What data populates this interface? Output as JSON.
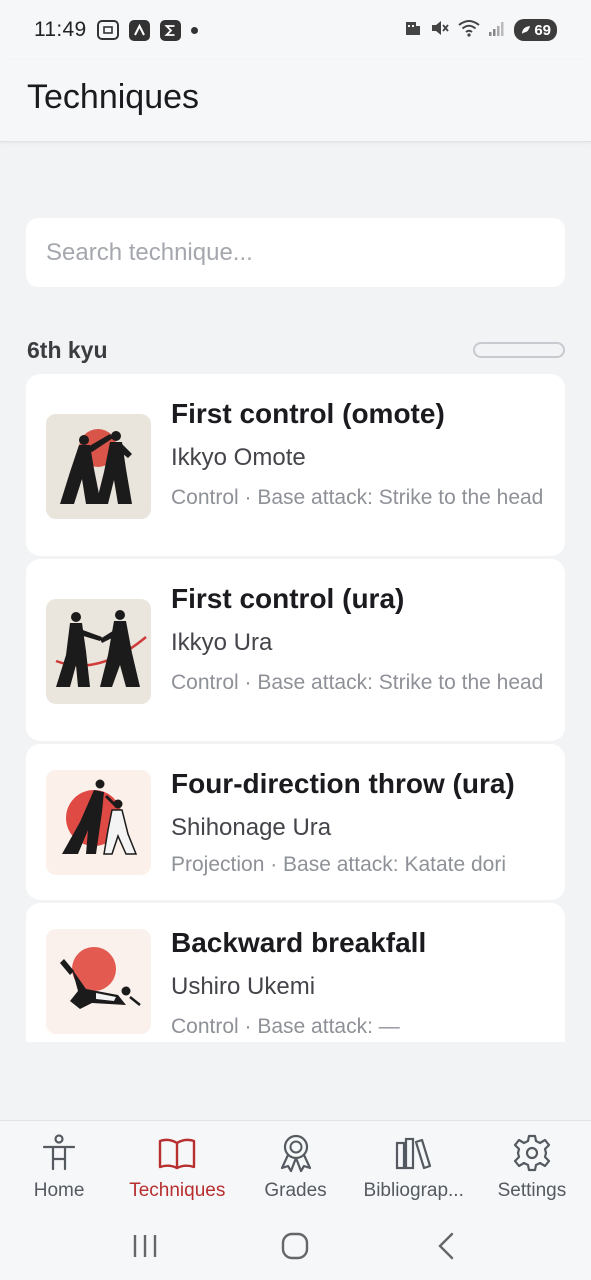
{
  "status_bar": {
    "time": "11:49",
    "battery": "69",
    "icons": [
      "screenshot-icon",
      "app-a-icon",
      "app-sigma-icon",
      "notification-dot-icon",
      "data-icon",
      "mute-icon",
      "wifi-icon",
      "signal-icon",
      "battery-icon"
    ]
  },
  "header": {
    "title": "Techniques"
  },
  "search": {
    "placeholder": "Search technique..."
  },
  "section": {
    "title": "6th kyu"
  },
  "techniques": [
    {
      "name": "First control (omote)",
      "japanese": "Ikkyo Omote",
      "meta": "Control · Base attack: Strike to the head",
      "thumb_bg": "#e9e4dc",
      "accent": "#d9554a"
    },
    {
      "name": "First control (ura)",
      "japanese": "Ikkyo Ura",
      "meta": "Control · Base attack: Strike to the head",
      "thumb_bg": "#ebe6dd",
      "accent": "#cf3b3b"
    },
    {
      "name": "Four-direction throw (ura)",
      "japanese": "Shihonage Ura",
      "meta": "Projection · Base attack: Katate dori",
      "thumb_bg": "#fbf1ea",
      "accent": "#df4b44"
    },
    {
      "name": "Backward breakfall",
      "japanese": "Ushiro Ukemi",
      "meta": "Control · Base attack: —",
      "thumb_bg": "#fbf1ec",
      "accent": "#e25a50"
    }
  ],
  "bottom_nav": [
    {
      "label": "Home",
      "icon": "person-icon",
      "active": false
    },
    {
      "label": "Techniques",
      "icon": "book-icon",
      "active": true
    },
    {
      "label": "Grades",
      "icon": "ribbon-badge-icon",
      "active": false
    },
    {
      "label": "Bibliograp...",
      "icon": "library-icon",
      "active": false
    },
    {
      "label": "Settings",
      "icon": "gear-icon",
      "active": false
    }
  ],
  "colors": {
    "accent": "#b72f2f",
    "background": "#f2f3f5",
    "card": "#ffffff",
    "muted_text": "#8e9197"
  }
}
